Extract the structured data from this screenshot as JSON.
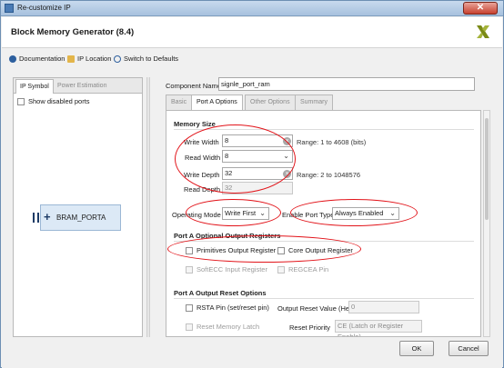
{
  "window": {
    "title": "Re-customize IP",
    "close": "✕"
  },
  "header": {
    "title": "Block Memory Generator (8.4)",
    "logo_icon": "xilinx-logo"
  },
  "toolbar": {
    "documentation": "Documentation",
    "ip_location": "IP Location",
    "switch_defaults": "Switch to Defaults"
  },
  "left": {
    "tabs": [
      "IP Symbol",
      "Power Estimation"
    ],
    "show_disabled": "Show disabled ports",
    "symbol": {
      "plus": "+",
      "label": "BRAM_PORTA"
    }
  },
  "component": {
    "label": "Component Name",
    "value": "signle_port_ram"
  },
  "tabs": [
    "Basic",
    "Port A Options",
    "Other Options",
    "Summary"
  ],
  "memory_size": {
    "title": "Memory Size",
    "write_width_label": "Write Width",
    "write_width": "8",
    "write_width_range": "Range: 1 to 4608 (bits)",
    "read_width_label": "Read Width",
    "read_width": "8",
    "write_depth_label": "Write Depth",
    "write_depth": "32",
    "write_depth_range": "Range: 2 to 1048576",
    "read_depth_label": "Read Depth",
    "read_depth": "32"
  },
  "operating": {
    "mode_label": "Operating Mode",
    "mode": "Write First",
    "enable_label": "Enable Port Type",
    "enable": "Always Enabled"
  },
  "optional": {
    "title": "Port A Optional Output Registers",
    "primitives": "Primitives Output Register",
    "core": "Core Output Register",
    "softecc": "SoftECC Input Register",
    "regcea": "REGCEA Pin"
  },
  "reset": {
    "title": "Port A Output Reset Options",
    "rsta": "RSTA Pin (set/reset pin)",
    "value_label": "Output Reset Value (Hex)",
    "value": "0",
    "latch": "Reset Memory Latch",
    "priority_label": "Reset Priority",
    "priority": "CE (Latch or Register Enable)"
  },
  "footer": {
    "ok": "OK",
    "cancel": "Cancel"
  },
  "colors": {
    "annotation": "#e2141a",
    "accent": "#4a7bb5"
  }
}
